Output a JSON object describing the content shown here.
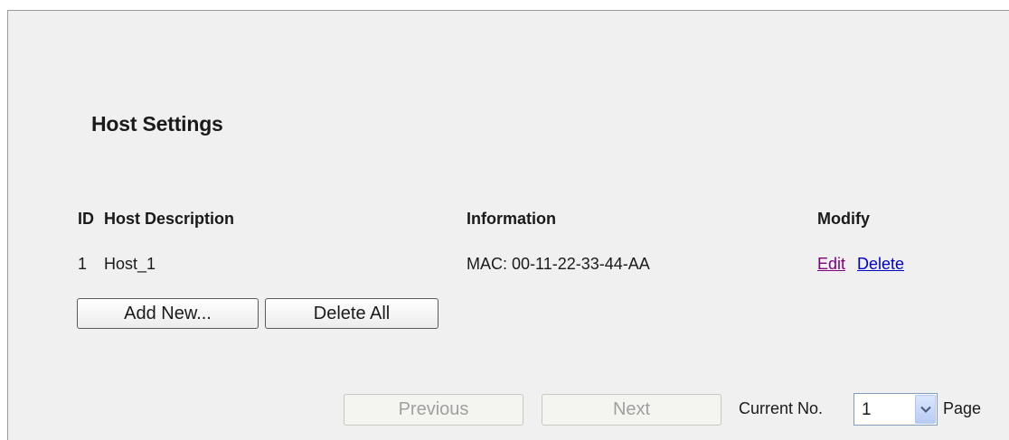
{
  "page": {
    "title": "Host Settings"
  },
  "table": {
    "headers": {
      "id": "ID",
      "description": "Host Description",
      "information": "Information",
      "modify": "Modify"
    },
    "rows": [
      {
        "id": "1",
        "description": "Host_1",
        "information": "MAC: 00-11-22-33-44-AA",
        "edit_label": "Edit",
        "delete_label": "Delete"
      }
    ]
  },
  "actions": {
    "add_new_label": "Add New...",
    "delete_all_label": "Delete All"
  },
  "pagination": {
    "previous_label": "Previous",
    "next_label": "Next",
    "current_label": "Current No.",
    "page_label": "Page",
    "current_page": "1",
    "icon": "chevron-down-icon"
  },
  "colors": {
    "panel_background": "#f0f0f0",
    "visited_link": "#800080",
    "link": "#0000cc",
    "disabled_text": "#a0a0a0"
  }
}
